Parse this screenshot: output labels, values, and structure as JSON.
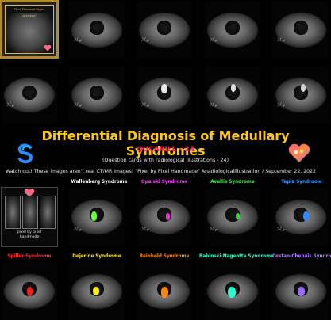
{
  "cover_card": {
    "title": "\"Los Dermatologos Artistas\"",
    "subtitle": "ilustracion radiologica"
  },
  "banner": {
    "title": "Differential Diagnosis of Medullary Syndromes",
    "series": "QUCARILL - 24",
    "subtitle": "(Question cards with radiological illustrations - 24)",
    "notice": "Watch out!   These images aren't real CT/MR images!   \"Pixel by Pixel Handmade\"  Anadiologicalillustration  / September 22, 2022"
  },
  "preview_card": {
    "caption": "pixel by pixel handmade"
  },
  "row3_labels": [
    {
      "text": "Wallenberg Syndrome",
      "color": "#ffffff"
    },
    {
      "text": "Opalski Syndrome",
      "color": "#ff33ff"
    },
    {
      "text": "Avellis Syndrome",
      "color": "#33ff33"
    },
    {
      "text": "Tapia Syndrome",
      "color": "#3399ff"
    }
  ],
  "row4_labels": [
    {
      "text": "Spiller Syndrome",
      "color": "#ff2a2a"
    },
    {
      "text": "Dejerine Syndrome",
      "color": "#ffe600"
    },
    {
      "text": "Reinhold Syndrome",
      "color": "#ff8a00"
    },
    {
      "text": "Babinski-Nageotte Syndrome",
      "color": "#33ffcc"
    },
    {
      "text": "Cestan-Chenais Syndrome",
      "color": "#b07cff"
    }
  ],
  "icons": [
    "s-logo-icon",
    "heart-logo-icon"
  ],
  "colors": {
    "banner_title": "#ffc815",
    "series": "#ff1e69",
    "frame": "#b08a2c"
  }
}
